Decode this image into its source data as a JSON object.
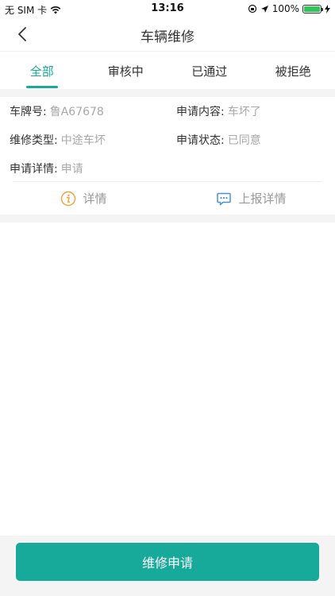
{
  "status_bar": {
    "carrier": "无 SIM 卡",
    "time": "13:16",
    "battery_percent": "100%",
    "battery_level": 1.0
  },
  "nav": {
    "title": "车辆维修"
  },
  "tabs": [
    {
      "label": "全部",
      "active": true
    },
    {
      "label": "审核中",
      "active": false
    },
    {
      "label": "已通过",
      "active": false
    },
    {
      "label": "被拒绝",
      "active": false
    }
  ],
  "record": {
    "plate_label": "车牌号:",
    "plate_value": "鲁A67678",
    "content_label": "申请内容:",
    "content_value": "车坏了",
    "type_label": "维修类型:",
    "type_value": "中途车坏",
    "status_label": "申请状态:",
    "status_value": "已同意",
    "detail_label": "申请详情:",
    "detail_value": "申请",
    "action_detail": "详情",
    "action_report": "上报详情"
  },
  "footer": {
    "submit_label": "维修申请"
  },
  "colors": {
    "accent": "#17a99a",
    "info_icon": "#f0a33b",
    "report_icon": "#4a90d9"
  }
}
